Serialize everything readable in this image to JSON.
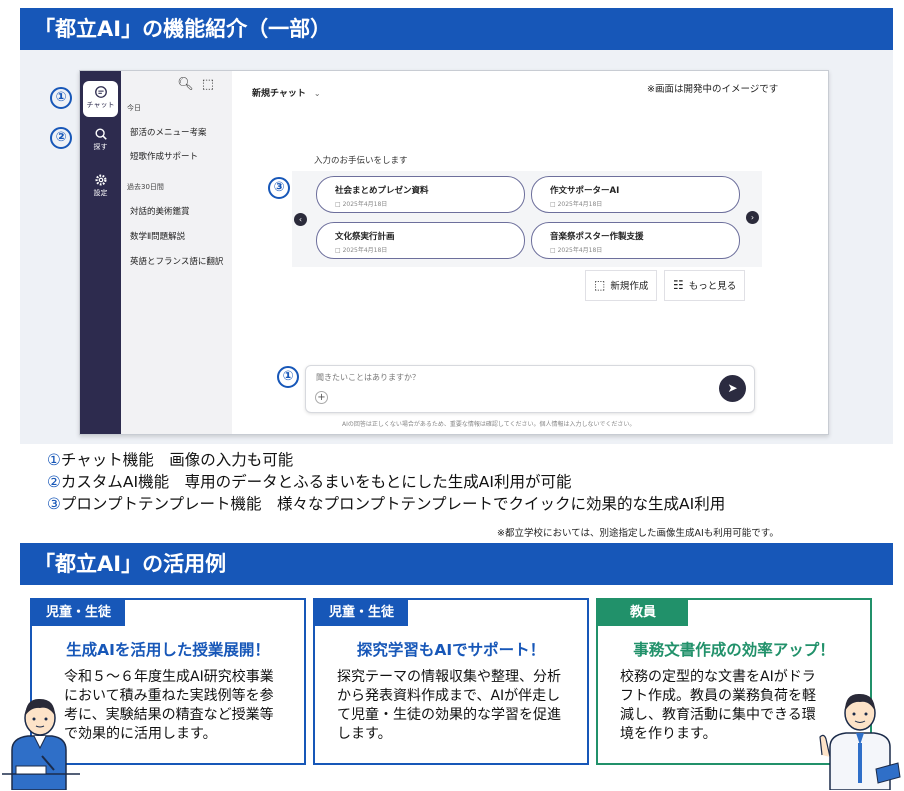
{
  "section1": {
    "title": "「都立AI」の機能紹介（一部）"
  },
  "app": {
    "rail": [
      {
        "label": "チャット",
        "icon": "chat-bubble-icon"
      },
      {
        "label": "探す",
        "icon": "search-icon"
      },
      {
        "label": "設定",
        "icon": "gear-icon"
      }
    ],
    "sidebar": {
      "today_label": "今日",
      "today_items": [
        "部活のメニュー考案",
        "短歌作成サポート"
      ],
      "past_label": "過去30日間",
      "past_items": [
        "対話的美術鑑賞",
        "数学Ⅱ問題解説",
        "英語とフランス語に翻訳"
      ]
    },
    "new_chat_label": "新規チャット",
    "notice": "※画面は開発中のイメージです",
    "help_label": "入力のお手伝いをします",
    "templates": [
      {
        "title": "社会まとめプレゼン資料",
        "date": "2025年4月18日"
      },
      {
        "title": "作文サポーターAI",
        "date": "2025年4月18日"
      },
      {
        "title": "文化祭実行計画",
        "date": "2025年4月18日"
      },
      {
        "title": "音楽祭ポスター作製支援",
        "date": "2025年4月18日"
      }
    ],
    "new_create_label": "新規作成",
    "more_label": "もっと見る",
    "chat_placeholder": "聞きたいことはありますか？",
    "disclaimer": "AIの回答は正しくない場合があるため、重要な情報は確認してください。個人情報は入力しないでください。"
  },
  "markers": {
    "m1": "①",
    "m2": "②",
    "m3": "③"
  },
  "features": [
    {
      "num": "①",
      "text": "チャット機能　画像の入力も可能"
    },
    {
      "num": "②",
      "text": "カスタムAI機能　専用のデータとふるまいをもとにした生成AI利用が可能"
    },
    {
      "num": "③",
      "text": "プロンプトテンプレート機能　様々なプロンプトテンプレートでクイックに効果的な生成AI利用"
    }
  ],
  "footnote": "※都立学校においては、別途指定した画像生成AIも利用可能です。",
  "section2": {
    "title": "「都立AI」の活用例"
  },
  "cases": [
    {
      "tag": "児童・生徒",
      "title": "生成AIを活用した授業展開！",
      "body": "令和５～６年度生成AI研究校事業において積み重ねた実践例等を参考に、実験結果の精査など授業等で効果的に活用します。"
    },
    {
      "tag": "児童・生徒",
      "title": "探究学習もAIでサポート！",
      "body": "探究テーマの情報収集や整理、分析から発表資料作成まで、AIが伴走して児童・生徒の効果的な学習を促進します。"
    },
    {
      "tag": "教員",
      "title": "事務文書作成の効率アップ！",
      "body": "校務の定型的な文書をAIがドラフト作成。教員の業務負荷を軽減し、教育活動に集中できる環境を作ります。"
    }
  ],
  "colors": {
    "brand_blue": "#1757b8",
    "staff_green": "#21916a",
    "rail_navy": "#2d2b4e"
  }
}
